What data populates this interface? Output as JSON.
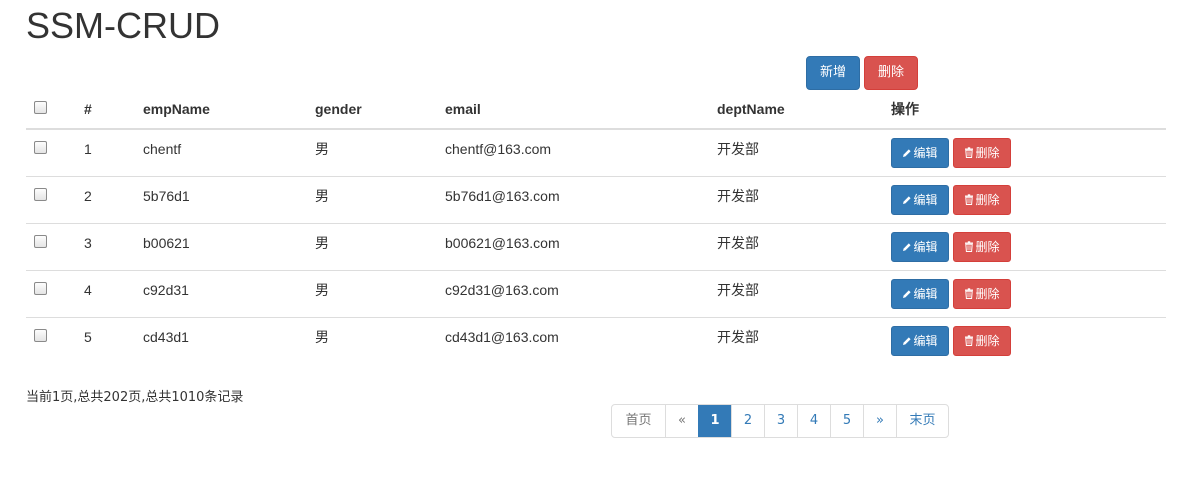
{
  "page": {
    "title": "SSM-CRUD"
  },
  "toolbar": {
    "add_label": "新增",
    "delete_label": "删除"
  },
  "table": {
    "headers": {
      "num": "#",
      "name": "empName",
      "gender": "gender",
      "email": "email",
      "dept": "deptName",
      "actions": "操作"
    },
    "edit_label": "编辑",
    "delete_label": "删除",
    "rows": [
      {
        "id": "1",
        "name": "chentf",
        "gender": "男",
        "email": "chentf@163.com",
        "dept": "开发部"
      },
      {
        "id": "2",
        "name": "5b76d1",
        "gender": "男",
        "email": "5b76d1@163.com",
        "dept": "开发部"
      },
      {
        "id": "3",
        "name": "b00621",
        "gender": "男",
        "email": "b00621@163.com",
        "dept": "开发部"
      },
      {
        "id": "4",
        "name": "c92d31",
        "gender": "男",
        "email": "c92d31@163.com",
        "dept": "开发部"
      },
      {
        "id": "5",
        "name": "cd43d1",
        "gender": "男",
        "email": "cd43d1@163.com",
        "dept": "开发部"
      }
    ]
  },
  "footer": {
    "info": "当前1页,总共202页,总共1010条记录"
  },
  "pagination": {
    "first": "首页",
    "prev": "«",
    "pages": [
      "1",
      "2",
      "3",
      "4",
      "5"
    ],
    "active_page": "1",
    "next": "»",
    "last": "末页"
  },
  "colors": {
    "primary": "#337ab7",
    "danger": "#d9534f",
    "border": "#dddddd",
    "text": "#333333"
  },
  "icons": {
    "edit": "pencil-icon",
    "delete": "trash-icon"
  }
}
